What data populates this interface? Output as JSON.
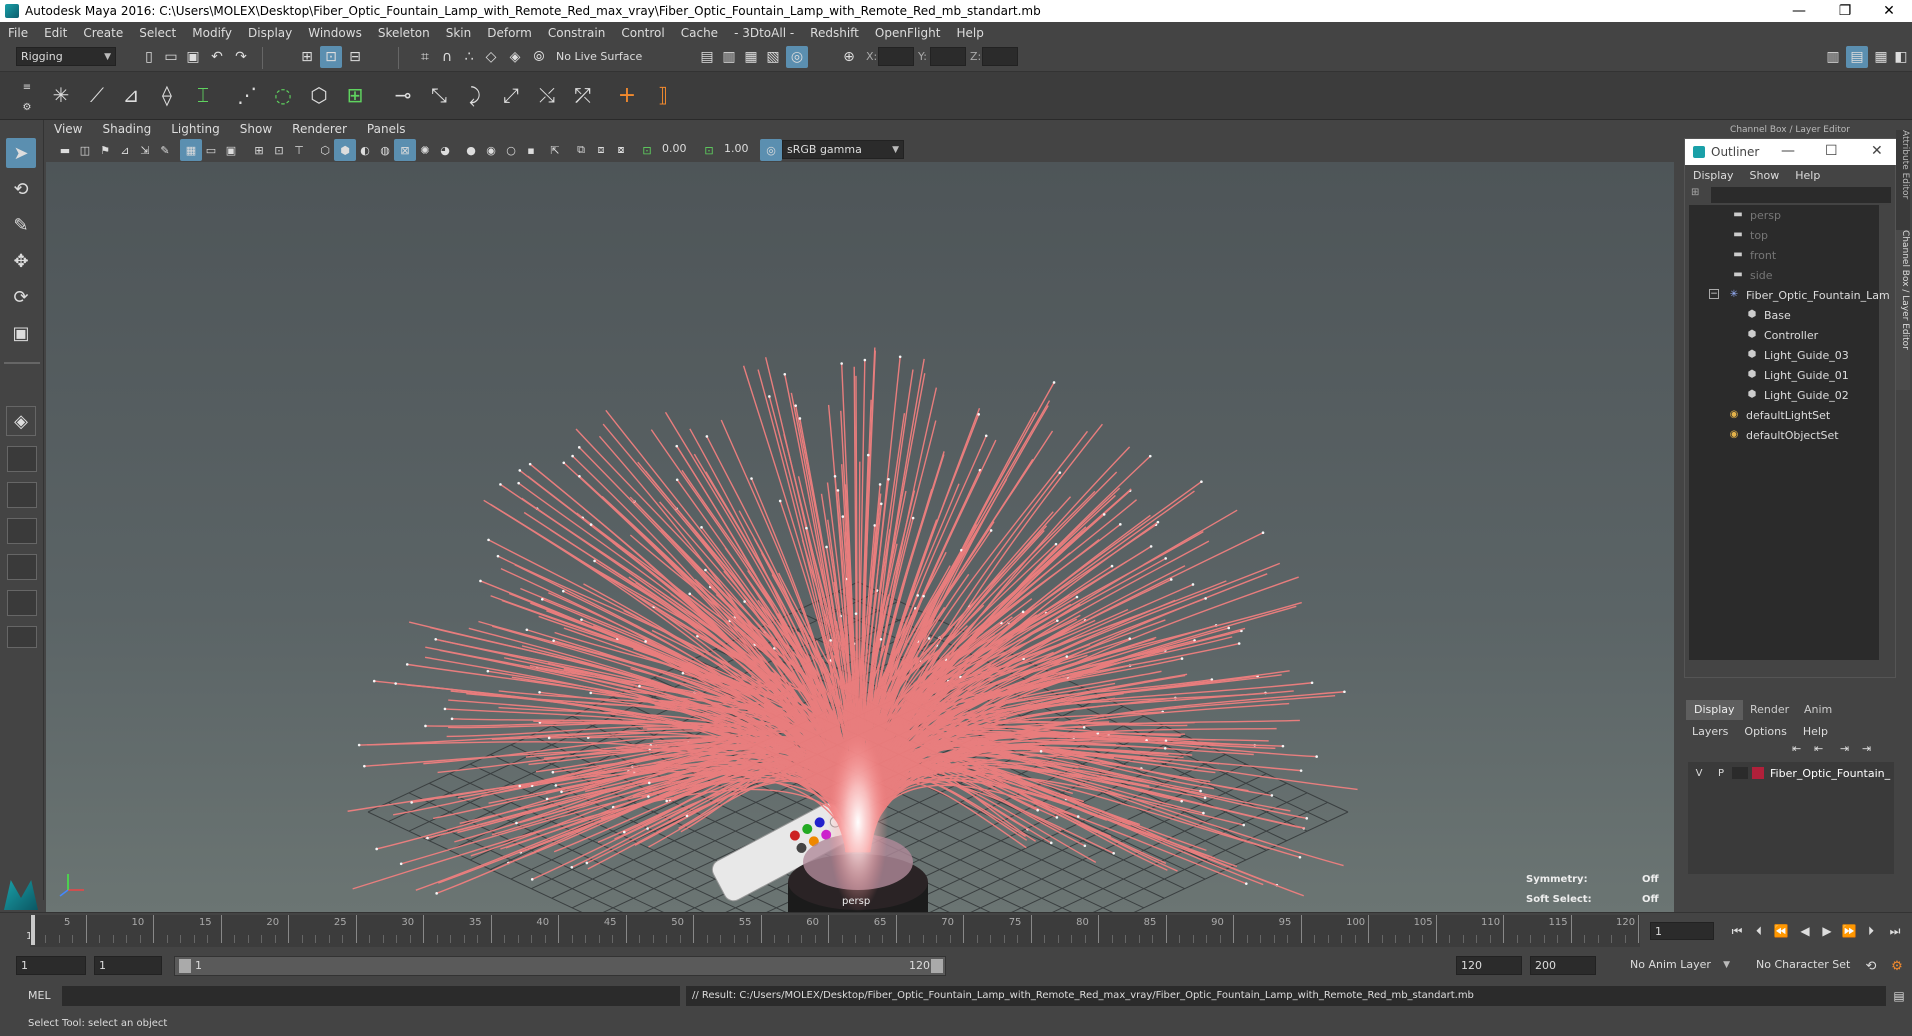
{
  "window": {
    "title": "Autodesk Maya 2016: C:\\Users\\MOLEX\\Desktop\\Fiber_Optic_Fountain_Lamp_with_Remote_Red_max_vray\\Fiber_Optic_Fountain_Lamp_with_Remote_Red_mb_standart.mb",
    "minimize": "—",
    "restore": "❐",
    "close": "✕"
  },
  "menubar": [
    "File",
    "Edit",
    "Create",
    "Select",
    "Modify",
    "Display",
    "Windows",
    "Skeleton",
    "Skin",
    "Deform",
    "Constrain",
    "Control",
    "Cache",
    "- 3DtoAll -",
    "Redshift",
    "OpenFlight",
    "Help"
  ],
  "status_line": {
    "mode": "Rigging",
    "live_surface": "No Live Surface",
    "x_label": "X:",
    "y_label": "Y:",
    "z_label": "Z:"
  },
  "viewport_menu": [
    "View",
    "Shading",
    "Lighting",
    "Show",
    "Renderer",
    "Panels"
  ],
  "viewport_toolbar": {
    "exposure": "0.00",
    "gamma": "1.00",
    "color_space": "sRGB gamma"
  },
  "viewport": {
    "camera_label": "persp",
    "symmetry_label": "Symmetry:",
    "symmetry_value": "Off",
    "soft_select_label": "Soft Select:",
    "soft_select_value": "Off"
  },
  "right_panel": {
    "header": "Channel Box / Layer Editor",
    "side_tab_1": "Attribute Editor",
    "side_tab_2": "Channel Box / Layer Editor"
  },
  "outliner": {
    "title": "Outliner",
    "menu": [
      "Display",
      "Show",
      "Help"
    ],
    "items": [
      {
        "label": "persp",
        "icon": "camera-icon",
        "dim": true
      },
      {
        "label": "top",
        "icon": "camera-icon",
        "dim": true
      },
      {
        "label": "front",
        "icon": "camera-icon",
        "dim": true
      },
      {
        "label": "side",
        "icon": "camera-icon",
        "dim": true
      },
      {
        "label": "Fiber_Optic_Fountain_Lam",
        "icon": "group-icon",
        "dim": false
      },
      {
        "label": "Base",
        "icon": "mesh-icon",
        "dim": false
      },
      {
        "label": "Controller",
        "icon": "mesh-icon",
        "dim": false
      },
      {
        "label": "Light_Guide_03",
        "icon": "mesh-icon",
        "dim": false
      },
      {
        "label": "Light_Guide_01",
        "icon": "mesh-icon",
        "dim": false
      },
      {
        "label": "Light_Guide_02",
        "icon": "mesh-icon",
        "dim": false
      },
      {
        "label": "defaultLightSet",
        "icon": "set-icon",
        "dim": false
      },
      {
        "label": "defaultObjectSet",
        "icon": "set-icon",
        "dim": false
      }
    ]
  },
  "layer_editor": {
    "tabs": [
      "Display",
      "Render",
      "Anim"
    ],
    "menu": [
      "Layers",
      "Options",
      "Help"
    ],
    "layer": {
      "v": "V",
      "p": "P",
      "name": "Fiber_Optic_Fountain_",
      "color": "#b0203a"
    }
  },
  "timeline": {
    "labels": [
      "5",
      "10",
      "15",
      "20",
      "25",
      "30",
      "35",
      "40",
      "45",
      "50",
      "55",
      "60",
      "65",
      "70",
      "75",
      "80",
      "85",
      "90",
      "95",
      "100",
      "105",
      "110",
      "115",
      "120"
    ],
    "current_frame": "1",
    "first_tick": "1"
  },
  "range": {
    "start": "1",
    "playback_start": "1",
    "slider_start": "1",
    "slider_end": "120",
    "playback_end": "120",
    "end": "200",
    "anim_layer": "No Anim Layer",
    "character_set": "No Character Set"
  },
  "command_line": {
    "language": "MEL",
    "result": "// Result: C:/Users/MOLEX/Desktop/Fiber_Optic_Fountain_Lamp_with_Remote_Red_max_vray/Fiber_Optic_Fountain_Lamp_with_Remote_Red_mb_standart.mb"
  },
  "help_line": "Select Tool: select an object",
  "colors": {
    "fiber": "#f07f7f",
    "selection": "#5b8fb0",
    "layer_color": "#b0203a"
  }
}
